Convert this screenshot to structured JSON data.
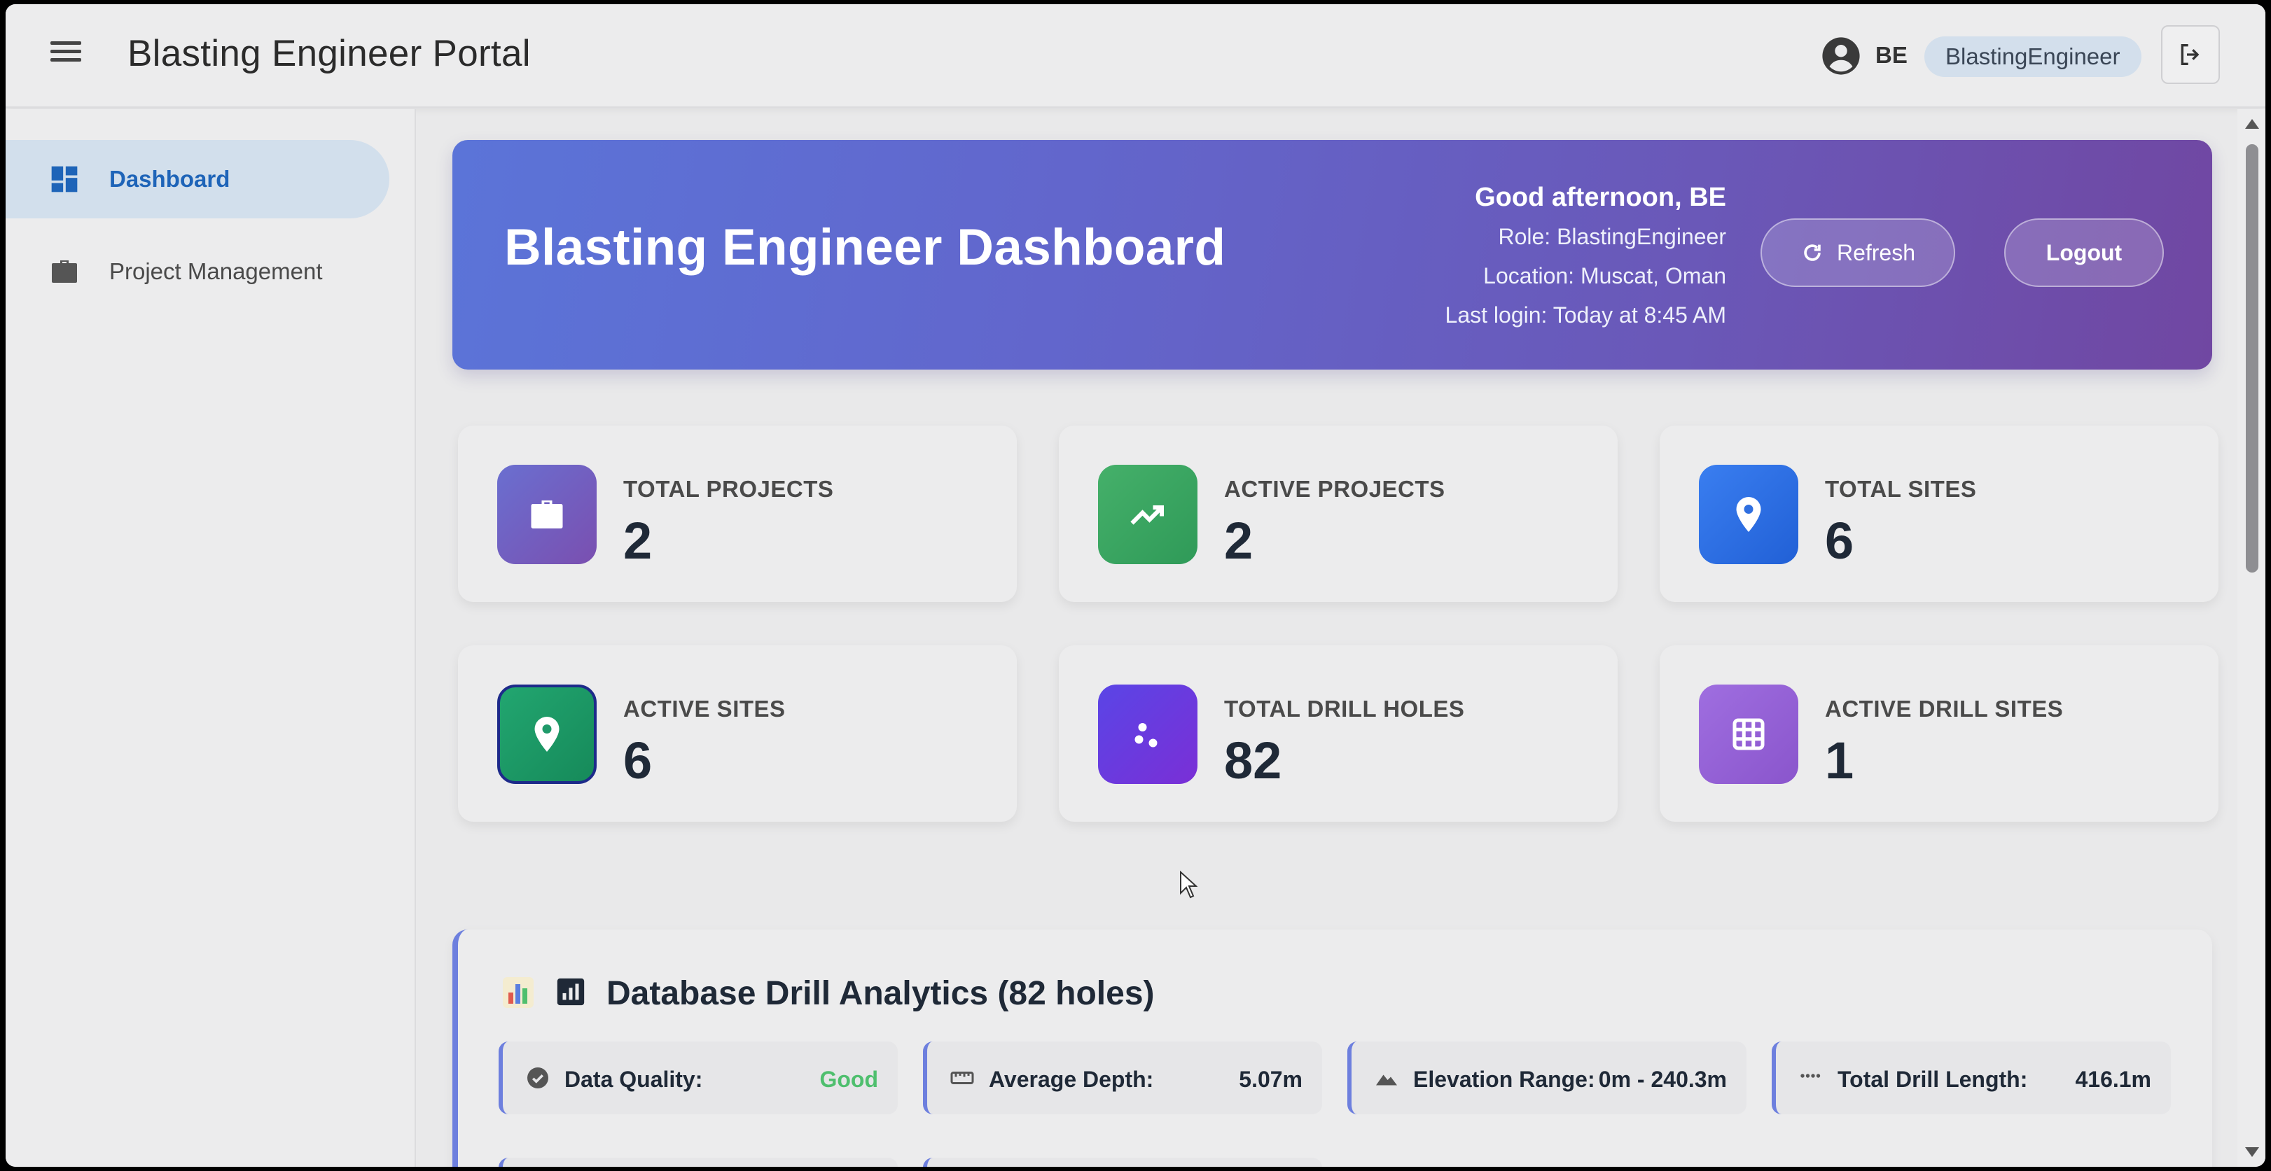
{
  "app": {
    "title": "Blasting Engineer Portal",
    "user_initials": "BE",
    "user_role_chip": "BlastingEngineer"
  },
  "sidebar": {
    "items": [
      {
        "label": "Dashboard",
        "icon": "dashboard-icon",
        "active": true
      },
      {
        "label": "Project Management",
        "icon": "briefcase-icon",
        "active": false
      }
    ]
  },
  "hero": {
    "title": "Blasting Engineer Dashboard",
    "greeting": "Good afternoon, BE",
    "role": "Role: BlastingEngineer",
    "location": "Location: Muscat, Oman",
    "last_login": "Last login: Today at 8:45 AM",
    "refresh_label": "Refresh",
    "logout_label": "Logout"
  },
  "stats": [
    {
      "label": "TOTAL PROJECTS",
      "value": "2",
      "icon": "briefcase-icon",
      "color": "#6a5bc0"
    },
    {
      "label": "ACTIVE PROJECTS",
      "value": "2",
      "icon": "trending-up-icon",
      "color": "#3fa45f"
    },
    {
      "label": "TOTAL SITES",
      "value": "6",
      "icon": "location-pin-icon",
      "color": "#2f6fe0"
    },
    {
      "label": "ACTIVE SITES",
      "value": "6",
      "icon": "location-pin-icon",
      "color": "#1f9a6a"
    },
    {
      "label": "TOTAL DRILL HOLES",
      "value": "82",
      "icon": "scatter-dots-icon",
      "color": "#6a3fe0"
    },
    {
      "label": "ACTIVE DRILL SITES",
      "value": "1",
      "icon": "grid-icon",
      "color": "#9a63d8"
    }
  ],
  "analytics": {
    "title": "Database Drill Analytics (82 holes)",
    "metrics": [
      {
        "label": "Data Quality:",
        "value": "Good",
        "icon": "check-circle-icon"
      },
      {
        "label": "Average Depth:",
        "value": "5.07m",
        "icon": "ruler-icon"
      },
      {
        "label": "Elevation Range:",
        "value": "0m - 240.3m",
        "icon": "terrain-icon"
      },
      {
        "label": "Total Drill Length:",
        "value": "416.1m",
        "icon": "dotted-line-icon"
      }
    ]
  }
}
